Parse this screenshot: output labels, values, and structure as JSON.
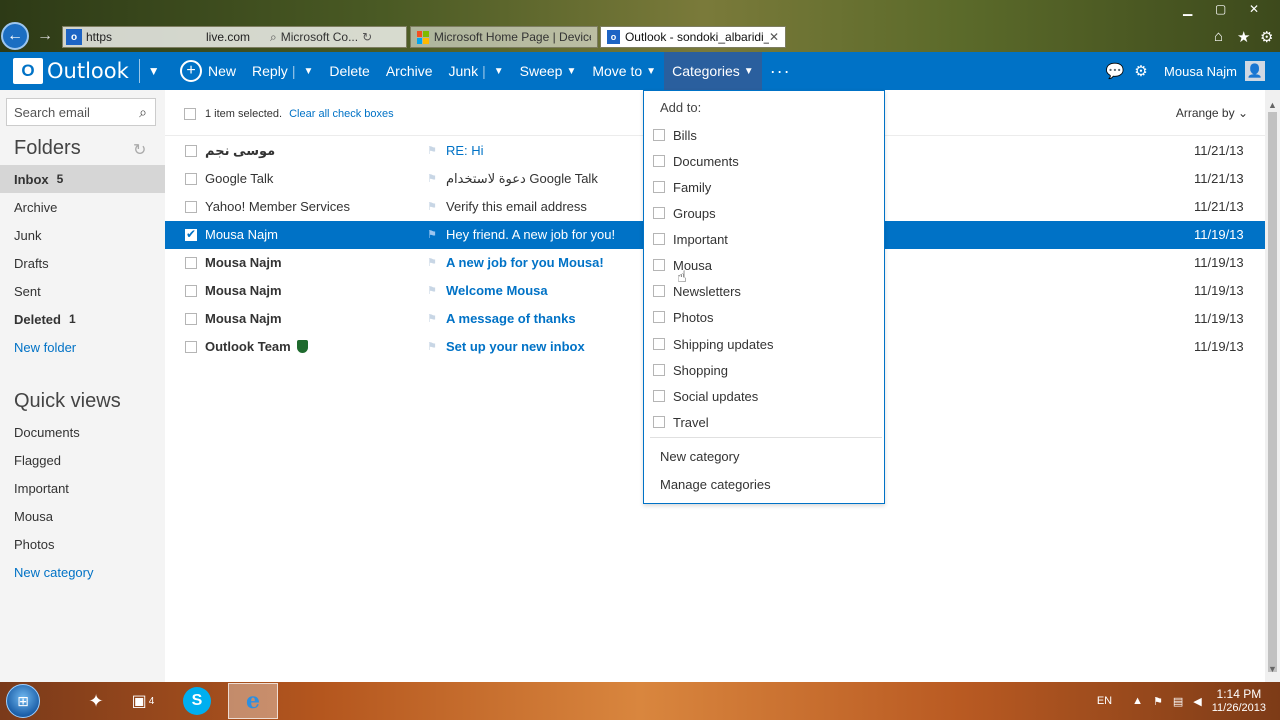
{
  "browser": {
    "address_prefix": "https",
    "address_host": "live.com",
    "tab_in_address": "Microsoft Co...",
    "tabs": [
      {
        "label": "Microsoft Home Page | Device..."
      },
      {
        "label": "Outlook - sondoki_albaridi_..."
      }
    ]
  },
  "header": {
    "brand": "Outlook",
    "commands": {
      "new": "New",
      "reply": "Reply",
      "delete": "Delete",
      "archive": "Archive",
      "junk": "Junk",
      "sweep": "Sweep",
      "move_to": "Move to",
      "categories": "Categories",
      "more": "···"
    },
    "user_name": "Mousa Najm"
  },
  "sidebar": {
    "search_placeholder": "Search email",
    "folders_title": "Folders",
    "folders": [
      {
        "label": "Inbox",
        "count": "5"
      },
      {
        "label": "Archive"
      },
      {
        "label": "Junk"
      },
      {
        "label": "Drafts"
      },
      {
        "label": "Sent"
      },
      {
        "label": "Deleted",
        "count": "1"
      },
      {
        "label": "New folder"
      }
    ],
    "quick_views_title": "Quick views",
    "quick_views": [
      {
        "label": "Documents"
      },
      {
        "label": "Flagged"
      },
      {
        "label": "Important"
      },
      {
        "label": "Mousa"
      },
      {
        "label": "Photos"
      },
      {
        "label": "New category"
      }
    ]
  },
  "list": {
    "selection_text": "1 item selected.",
    "clear_link": "Clear all check boxes",
    "arrange_by": "Arrange by",
    "messages": [
      {
        "from": "موسى نجم",
        "subject": "RE: Hi",
        "date": "11/21/13"
      },
      {
        "from": "Google Talk",
        "subject": "دعوة لاستخدام Google Talk",
        "date": "11/21/13"
      },
      {
        "from": "Yahoo! Member Services",
        "subject": "Verify this email address",
        "date": "11/21/13"
      },
      {
        "from": "Mousa Najm",
        "subject": "Hey friend. A new job for you!",
        "date": "11/19/13"
      },
      {
        "from": "Mousa Najm",
        "subject": "A new job for you Mousa!",
        "date": "11/19/13"
      },
      {
        "from": "Mousa Najm",
        "subject": "Welcome Mousa",
        "date": "11/19/13"
      },
      {
        "from": "Mousa Najm",
        "subject": "A message of thanks",
        "date": "11/19/13"
      },
      {
        "from": "Outlook Team",
        "subject": "Set up your new inbox",
        "date": "11/19/13"
      }
    ]
  },
  "categories_menu": {
    "header": "Add to:",
    "items": [
      {
        "label": "Bills"
      },
      {
        "label": "Documents"
      },
      {
        "label": "Family"
      },
      {
        "label": "Groups"
      },
      {
        "label": "Important"
      },
      {
        "label": "Mousa"
      },
      {
        "label": "Newsletters"
      },
      {
        "label": "Photos"
      },
      {
        "label": "Shipping updates"
      },
      {
        "label": "Shopping"
      },
      {
        "label": "Social updates"
      },
      {
        "label": "Travel"
      }
    ],
    "new_category": "New category",
    "manage_categories": "Manage categories"
  },
  "taskbar": {
    "language": "EN",
    "time": "1:14 PM",
    "date": "11/26/2013",
    "badge": "4"
  },
  "colors": {
    "accent": "#0072c6",
    "selected_row": "#0072c6"
  }
}
